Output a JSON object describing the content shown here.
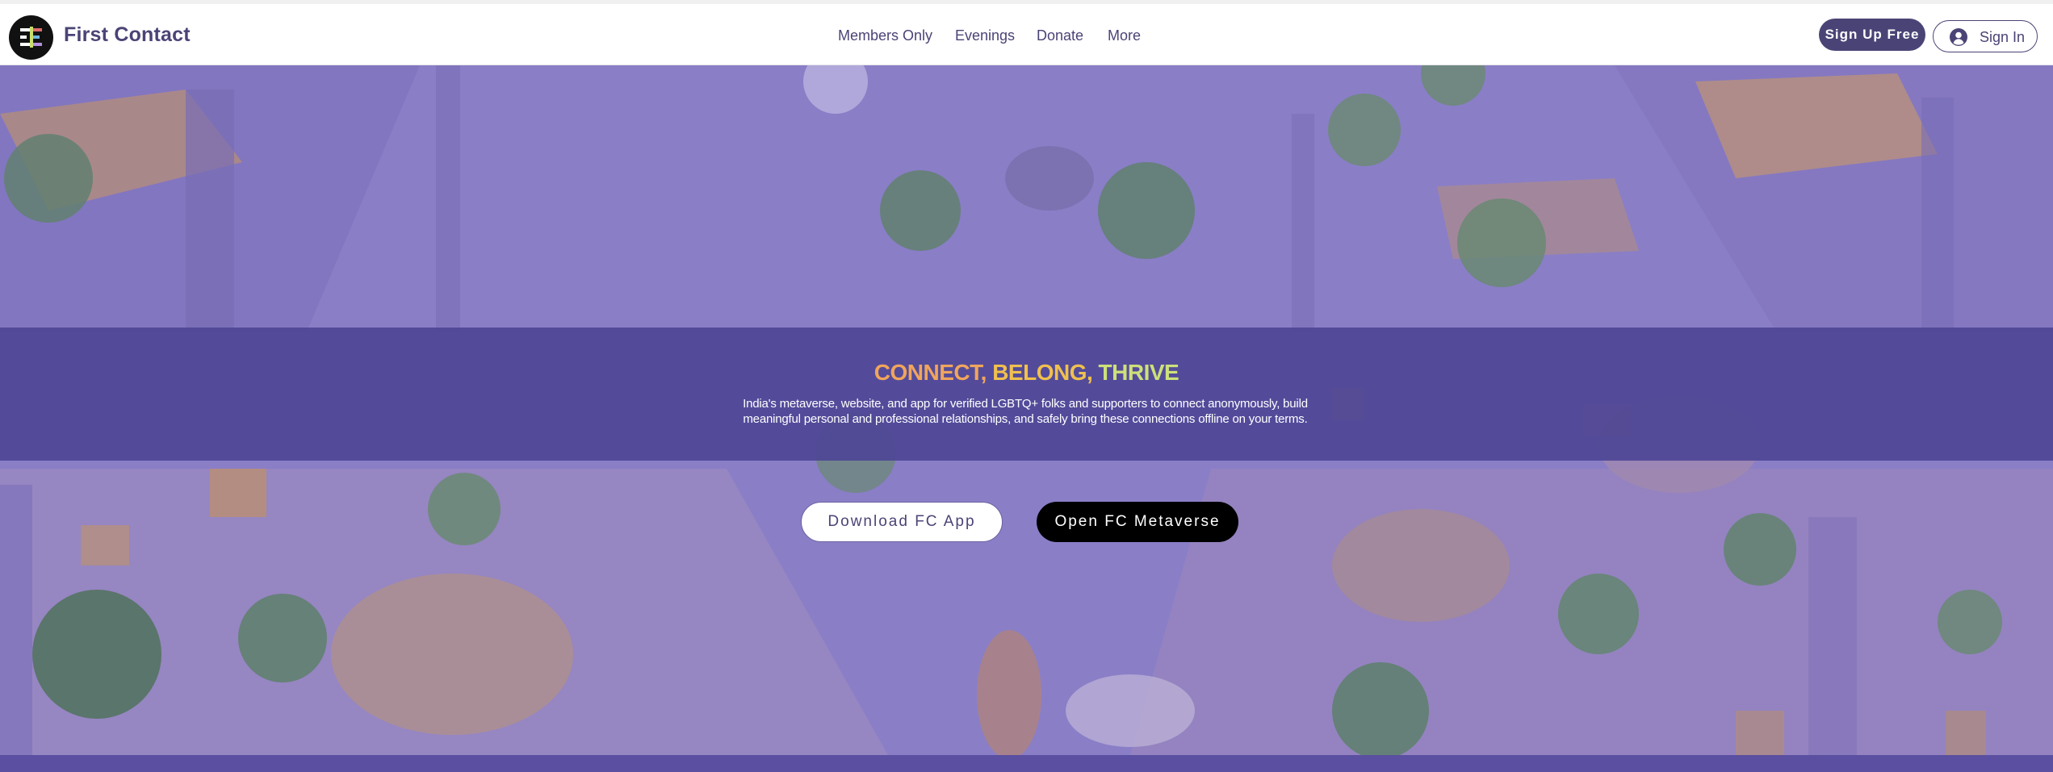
{
  "header": {
    "brand": "First Contact",
    "nav": [
      "Members Only",
      "Evenings",
      "Donate",
      "More"
    ],
    "signup_label": "Sign Up Free",
    "signin_label": "Sign In"
  },
  "hero": {
    "headline": {
      "connect": "CONNECT,",
      "belong": "BELONG,",
      "thrive": "THRIVE"
    },
    "subtext_line1": "India's metaverse, website, and app for verified LGBTQ+ folks and supporters to connect anonymously, build",
    "subtext_line2": "meaningful personal and professional relationships, and safely bring these connections offline on your terms.",
    "download_label": "Download FC App",
    "metaverse_label": "Open FC Metaverse"
  },
  "colors": {
    "brand_purple": "#4a4476",
    "band_purple": "#4e4696",
    "headline_orange": "#f0a55c",
    "headline_yellow": "#f0c04e",
    "headline_green": "#cde07a"
  },
  "icons": [
    "fc-logo-icon",
    "user-avatar-icon"
  ]
}
